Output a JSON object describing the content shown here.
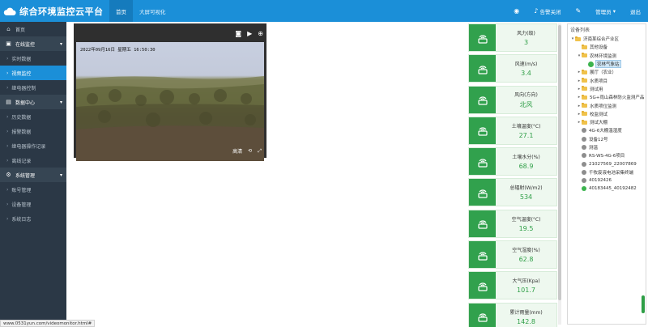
{
  "header": {
    "title": "综合环境监控云平台",
    "tabs": [
      {
        "label": "首页"
      },
      {
        "label": "大屏可视化"
      }
    ],
    "alarm_label": "告警关闭",
    "user_label": "管理员",
    "logout_label": "退出"
  },
  "sidebar": {
    "home": "首页",
    "online": "在线监控",
    "realtime": "实时数据",
    "video": "视频监控",
    "relay": "继电器控制",
    "data_center": "数据中心",
    "history": "历史数据",
    "alarm_data": "报警数据",
    "relay_log": "继电器操作记录",
    "offline_log": "离线记录",
    "system": "系统管理",
    "account": "账号管理",
    "device_mgmt": "设备管理",
    "syslog": "系统日志"
  },
  "video": {
    "timestamp": "2022年09月16日  星期五  16:50:30",
    "quality_label": "高清"
  },
  "sensors": [
    {
      "label": "风力(级)",
      "value": "3"
    },
    {
      "label": "风速(m/s)",
      "value": "3.4"
    },
    {
      "label": "风向(方向)",
      "value": "北风"
    },
    {
      "label": "土壤温度(°C)",
      "value": "27.1"
    },
    {
      "label": "土壤水分(%)",
      "value": "68.9"
    },
    {
      "label": "总辐射(W/m2)",
      "value": "534"
    },
    {
      "label": "空气温度(°C)",
      "value": "19.5"
    },
    {
      "label": "空气湿度(%)",
      "value": "62.8"
    },
    {
      "label": "大气压(Kpa)",
      "value": "101.7"
    },
    {
      "label": "累计雨量(mm)",
      "value": "142.8"
    }
  ],
  "device_panel": {
    "title": "设备列表",
    "tree": [
      {
        "label": "济南某综合产业区",
        "level": 0,
        "type": "folder",
        "arrow": "▾"
      },
      {
        "label": "其他设备",
        "level": 1,
        "type": "folder",
        "arrow": ""
      },
      {
        "label": "农林环境监测",
        "level": 1,
        "type": "folder",
        "arrow": "▾"
      },
      {
        "label": "农林气象站",
        "level": 2,
        "type": "leaf",
        "arrow": "",
        "selected": true
      },
      {
        "label": "展厅（农业）",
        "level": 1,
        "type": "folder",
        "arrow": "▸"
      },
      {
        "label": "水质项目",
        "level": 1,
        "type": "folder",
        "arrow": "▸"
      },
      {
        "label": "测试用",
        "level": 1,
        "type": "folder",
        "arrow": "▸"
      },
      {
        "label": "5G+雨山森林防火监测产品",
        "level": 1,
        "type": "folder",
        "arrow": "▸"
      },
      {
        "label": "水质项位监测",
        "level": 1,
        "type": "folder",
        "arrow": "▸"
      },
      {
        "label": "校监测试",
        "level": 1,
        "type": "folder",
        "arrow": "▸"
      },
      {
        "label": "测试大棚",
        "level": 1,
        "type": "folder",
        "arrow": "▸"
      },
      {
        "label": "4G-6大棚温湿度",
        "level": 1,
        "type": "device",
        "arrow": "",
        "online": false
      },
      {
        "label": "设备12号",
        "level": 1,
        "type": "device",
        "arrow": "",
        "online": false
      },
      {
        "label": "测温",
        "level": 1,
        "type": "device",
        "arrow": "",
        "online": false
      },
      {
        "label": "RS-WS-4G-6项目",
        "level": 1,
        "type": "device",
        "arrow": "",
        "online": false
      },
      {
        "label": "21027569_22007869",
        "level": 1,
        "type": "device",
        "arrow": "",
        "online": false
      },
      {
        "label": "千牧废液电池采集终端",
        "level": 1,
        "type": "device",
        "arrow": "",
        "online": false
      },
      {
        "label": "40192426",
        "level": 1,
        "type": "device",
        "arrow": "",
        "online": false
      },
      {
        "label": "40183445_40192482",
        "level": 1,
        "type": "device",
        "arrow": "",
        "online": true
      }
    ]
  },
  "status_url": "www.0531yun.com/videomonitor.html#"
}
